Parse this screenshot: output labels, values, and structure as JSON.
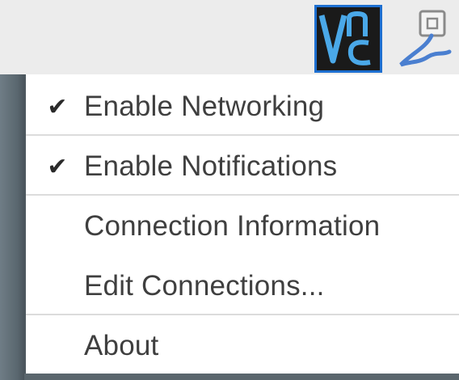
{
  "tray": {
    "vnc_icon": "vnc-server-icon",
    "network_icon": "network-cable-icon"
  },
  "menu": {
    "items": [
      {
        "label": "Enable Networking",
        "checked": true,
        "check_glyph": "✔"
      },
      {
        "label": "Enable Notifications",
        "checked": true,
        "check_glyph": "✔"
      },
      {
        "label": "Connection Information",
        "checked": false,
        "check_glyph": ""
      },
      {
        "label": "Edit Connections...",
        "checked": false,
        "check_glyph": ""
      },
      {
        "label": "About",
        "checked": false,
        "check_glyph": ""
      }
    ]
  },
  "colors": {
    "panel_bg": "#ececec",
    "vnc_bg": "#1a1a1a",
    "vnc_border": "#1e6fd0",
    "menu_text": "#3f3f3f",
    "desktop_edge": "#59666e"
  }
}
